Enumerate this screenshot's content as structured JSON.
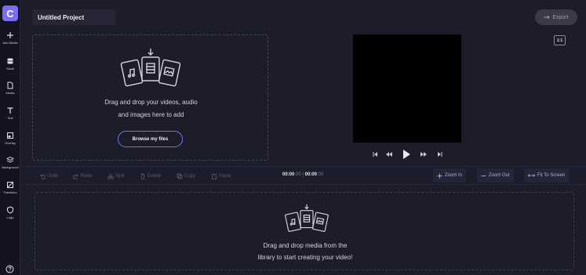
{
  "app": {
    "logo_letter": "C"
  },
  "sidebar": {
    "items": [
      {
        "label": "Add Media",
        "icon": "plus-icon"
      },
      {
        "label": "Stock",
        "icon": "stock-icon"
      },
      {
        "label": "Media",
        "icon": "file-icon"
      },
      {
        "label": "Text",
        "icon": "text-icon"
      },
      {
        "label": "Overlay",
        "icon": "overlay-icon"
      },
      {
        "label": "Background",
        "icon": "layers-icon"
      },
      {
        "label": "Transition",
        "icon": "transition-icon"
      },
      {
        "label": "Logo",
        "icon": "shield-icon"
      }
    ],
    "help_icon": "help-icon"
  },
  "header": {
    "project_title": "Untitled Project",
    "export_label": "Export"
  },
  "preview": {
    "aspect_ratio": "1:1"
  },
  "media_panel": {
    "drop_line1": "Drag and drop your videos, audio",
    "drop_line2": "and images here to add",
    "browse_label": "Browse my files"
  },
  "toolbar": {
    "undo": "Undo",
    "redo": "Redo",
    "split": "Split",
    "delete": "Delete",
    "copy": "Copy",
    "paste": "Paste",
    "current_time": "00:00",
    "current_frac": ".00",
    "separator": "|",
    "total_time": "00:00",
    "total_frac": ".00",
    "zoom_in": "Zoom In",
    "zoom_out": "Zoom Out",
    "fit": "Fit To Screen"
  },
  "timeline": {
    "drop_line1": "Drag and drop media from the",
    "drop_line2": "library to start creating your video!"
  },
  "colors": {
    "accent": "#7b6cf0",
    "background": "#1c1c2a",
    "preview": "#000000"
  }
}
